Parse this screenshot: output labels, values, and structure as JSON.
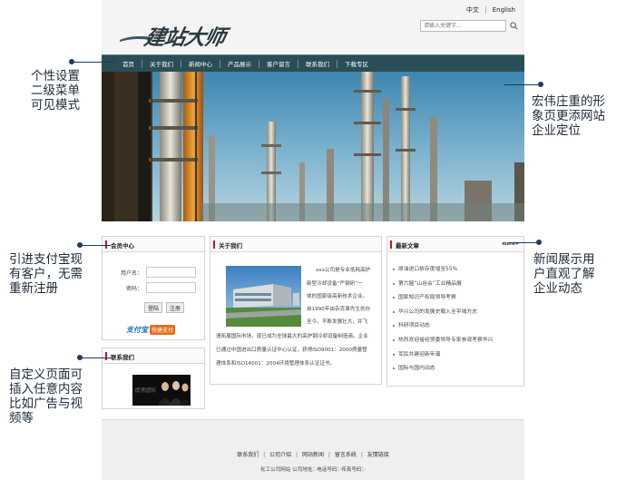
{
  "header": {
    "logo_text": "建站大师",
    "lang_cn": "中文",
    "lang_sep": "|",
    "lang_en": "English",
    "search_placeholder": "请输入关键字..."
  },
  "nav": {
    "items": [
      "首页",
      "关于我们",
      "新闻中心",
      "产品展示",
      "客户留言",
      "联系我们",
      "下载专区"
    ]
  },
  "member": {
    "title": "会员中心",
    "username_label": "用户名：",
    "password_label": "密码：",
    "login_label": "登陆",
    "register_label": "注册",
    "alipay_text": "支付宝",
    "quickpay_text": "快捷支付"
  },
  "contact": {
    "title": "联系我们",
    "image_caption": "优秀团队"
  },
  "about": {
    "title": "关于我们",
    "lines": [
      "xxx公司是专业低耗高护",
      "新型冷却设备“严钢研”一",
      "体的国家级高新技术企业。",
      "自1990年由杂克事先生创办",
      "至今，不断发展壮大，并飞",
      "速拓展国际市场，现已成为全球最大的高护钢冷却设备制造商。企业",
      "已通过中国进出口质量认证中心认证，获得ISO9001：2000质量管",
      "理体系和ISO14001：2004环境管理体系认证证书。"
    ]
  },
  "news": {
    "title": "最新文章",
    "more": "more+",
    "items": [
      "原油进口依存度增至55%",
      "第六届“山谷会”工业精品展",
      "国家知识产权局领导考察",
      "华兴公司的发展史载入全平域方志",
      "科研项目动态",
      "热烈欢迎省经贸委领导专家参观考察华兴",
      "军民共建迎新年谱",
      "国际与国内动态"
    ]
  },
  "footer": {
    "links": [
      "联系我们",
      "公司介绍",
      "网站新闻",
      "留言系统",
      "友情链接"
    ],
    "sep": "|",
    "info": "化工公司网站  公司地址：·电话号码：·传真号码：·"
  },
  "callouts": {
    "left_top": [
      "个性设置",
      "二级菜单",
      "可见模式"
    ],
    "right_top": [
      "宏伟庄重的形",
      "象页更添网站",
      "企业定位"
    ],
    "left_mid": [
      "引进支付宝现",
      "有客户，无需",
      "重新注册"
    ],
    "right_mid": [
      "新闻展示用",
      "户直观了解",
      "企业动态"
    ],
    "left_bottom": [
      "自定义页面可",
      "插入任意内容",
      "比如广告与视",
      "频等"
    ]
  },
  "colors": {
    "nav_bg": "#2a4d56",
    "accent_red": "#c8161d",
    "callout_text": "#1e2a38",
    "callout_line": "#1e3a64"
  }
}
